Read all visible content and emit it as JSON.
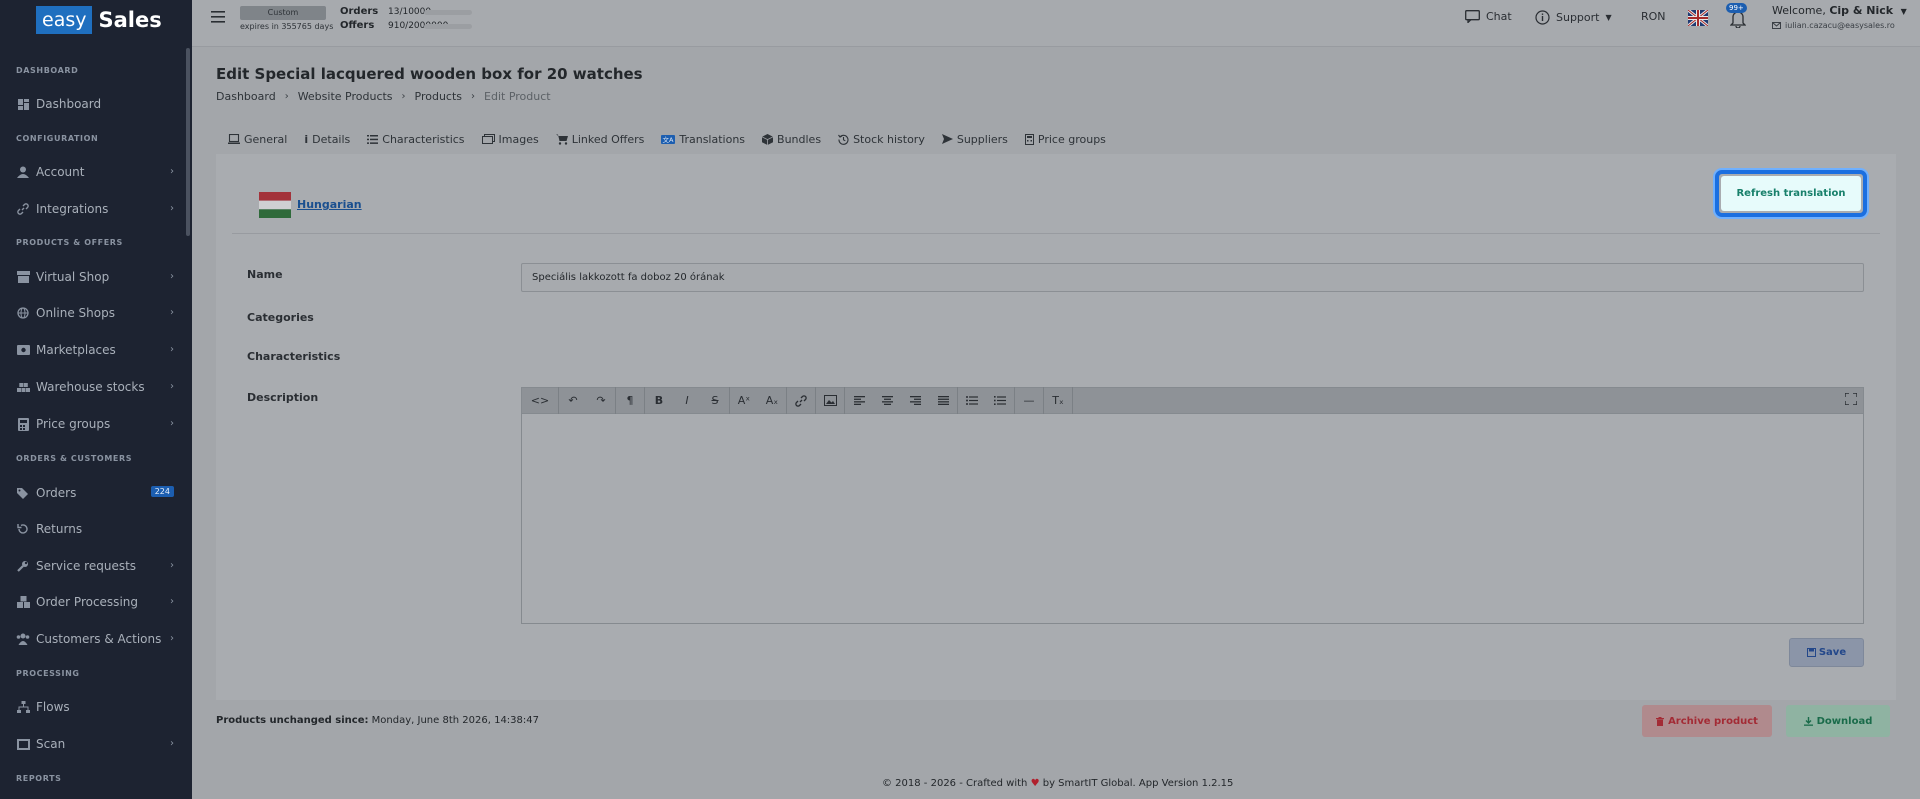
{
  "brand": {
    "box": "easy",
    "word": "Sales"
  },
  "sidebar": {
    "sections": [
      "DASHBOARD",
      "CONFIGURATION",
      "PRODUCTS & OFFERS",
      "ORDERS & CUSTOMERS",
      "PROCESSING",
      "REPORTS"
    ],
    "items": [
      {
        "label": "Dashboard",
        "icon": "dashboard-icon"
      },
      {
        "label": "Account",
        "icon": "user-icon"
      },
      {
        "label": "Integrations",
        "icon": "link-icon"
      },
      {
        "label": "Virtual Shop",
        "icon": "shop-icon"
      },
      {
        "label": "Online Shops",
        "icon": "globe-icon"
      },
      {
        "label": "Marketplaces",
        "icon": "money-icon"
      },
      {
        "label": "Warehouse stocks",
        "icon": "warehouse-icon"
      },
      {
        "label": "Price groups",
        "icon": "calculator-icon"
      },
      {
        "label": "Orders",
        "icon": "tags-icon",
        "badge": "224"
      },
      {
        "label": "Returns",
        "icon": "undo-icon"
      },
      {
        "label": "Service requests",
        "icon": "wrench-icon"
      },
      {
        "label": "Order Processing",
        "icon": "boxes-icon"
      },
      {
        "label": "Customers & Actions",
        "icon": "users-icon"
      },
      {
        "label": "Flows",
        "icon": "sitemap-icon"
      },
      {
        "label": "Scan",
        "icon": "barcode-icon"
      }
    ]
  },
  "topbar": {
    "plan": "Custom",
    "expires": "expires in 355765 days",
    "orders_label": "Orders",
    "orders_value": "13/10000",
    "offers_label": "Offers",
    "offers_value": "910/2000000",
    "chat": "Chat",
    "support": "Support",
    "currency": "RON",
    "notif_badge": "99+",
    "welcome_prefix": "Welcome, ",
    "welcome_name": "Cip & Nick",
    "email": "iulian.cazacu@easysales.ro"
  },
  "page": {
    "title": "Edit Special lacquered wooden box for 20 watches",
    "breadcrumb": [
      "Dashboard",
      "Website Products",
      "Products",
      "Edit Product"
    ]
  },
  "tabs": [
    {
      "label": "General",
      "icon": "laptop-icon"
    },
    {
      "label": "Details",
      "icon": "info-icon"
    },
    {
      "label": "Characteristics",
      "icon": "list-icon"
    },
    {
      "label": "Images",
      "icon": "images-icon"
    },
    {
      "label": "Linked Offers",
      "icon": "cart-icon"
    },
    {
      "label": "Translations",
      "icon": "language-icon",
      "active": true
    },
    {
      "label": "Bundles",
      "icon": "cube-icon"
    },
    {
      "label": "Stock history",
      "icon": "history-icon"
    },
    {
      "label": "Suppliers",
      "icon": "send-icon"
    },
    {
      "label": "Price groups",
      "icon": "calculator-icon"
    }
  ],
  "translation": {
    "language": "Hungarian",
    "refresh_label": "Refresh translation",
    "fields": {
      "name_label": "Name",
      "name_value": "Speciális lakkozott fa doboz 20 órának",
      "categories_label": "Categories",
      "characteristics_label": "Characteristics",
      "description_label": "Description"
    },
    "save_label": "Save"
  },
  "status": {
    "unchanged_label": "Products unchanged since:",
    "unchanged_value": " Monday, June 8th 2026, 14:38:47"
  },
  "actions": {
    "archive": "Archive product",
    "download": "Download"
  },
  "footer": {
    "before": "© 2018 - 2026 - Crafted with ",
    "after": " by SmartIT Global. App Version 1.2.15"
  },
  "colors": {
    "sidebar_bg": "#1d2331",
    "accent": "#1c5eb0",
    "refresh_border": "#1b6fe0",
    "refresh_text": "#18806b",
    "archive_text": "#a32b35",
    "download_text": "#1a6b4a"
  }
}
